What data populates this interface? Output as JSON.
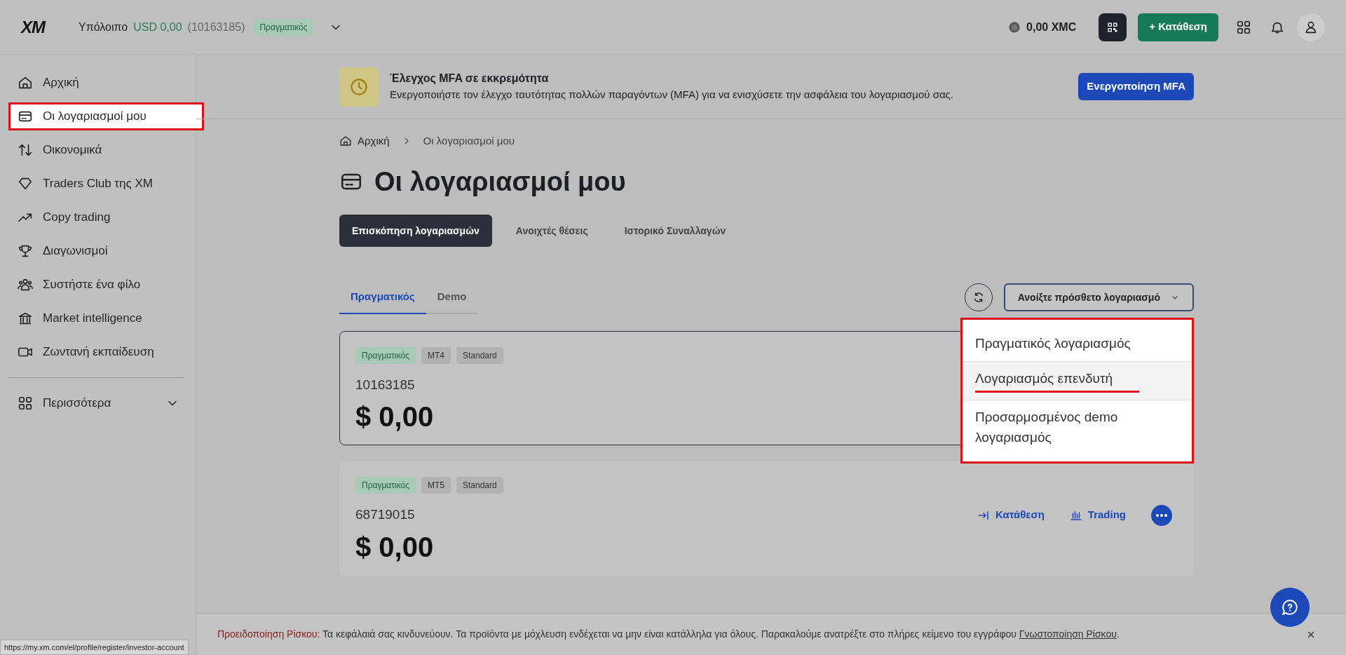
{
  "header": {
    "logo": "XM",
    "balance_label": "Υπόλοιπο",
    "balance": "USD 0,00",
    "account": "(10163185)",
    "account_type": "Πραγματικός",
    "xmc": "0,00 XMC",
    "deposit_button": "+ Κατάθεση"
  },
  "sidebar": {
    "items": [
      {
        "label": "Αρχική",
        "kind": "home",
        "selected": false
      },
      {
        "label": "Οι λογαριασμοί μου",
        "kind": "card",
        "selected": true
      },
      {
        "label": "Οικονομικά",
        "kind": "transfer",
        "selected": false
      },
      {
        "label": "Traders Club της XM",
        "kind": "diamond",
        "selected": false
      },
      {
        "label": "Copy trading",
        "kind": "trend",
        "selected": false
      },
      {
        "label": "Διαγωνισμοί",
        "kind": "trophy",
        "selected": false
      },
      {
        "label": "Συστήστε ένα φίλο",
        "kind": "people",
        "selected": false
      },
      {
        "label": "Market intelligence",
        "kind": "bank",
        "selected": false
      },
      {
        "label": "Ζωντανή εκπαίδευση",
        "kind": "video",
        "selected": false
      }
    ],
    "more": {
      "label": "Περισσότερα",
      "expanded": false
    }
  },
  "banner": {
    "title": "Έλεγχος MFA σε εκκρεμότητα",
    "text": "Ενεργοποιήστε τον έλεγχο ταυτότητας πολλών παραγόντων (MFA) για να ενισχύσετε την ασφάλεια του λογαριασμού σας.",
    "button": "Ενεργοποίηση MFA"
  },
  "breadcrumb": [
    "Αρχική",
    "Οι λογαριασμοί μου"
  ],
  "page_title": "Οι λογαριασμοί μου",
  "view_tabs": [
    {
      "label": "Επισκόπηση λογαριασμών",
      "selected": true
    },
    {
      "label": "Ανοιχτές θέσεις",
      "selected": false
    },
    {
      "label": "Ιστορικό Συναλλαγών",
      "selected": false
    }
  ],
  "account_tabs": [
    {
      "label": "Πραγματικός",
      "selected": true
    },
    {
      "label": "Demo",
      "selected": false
    }
  ],
  "open_account_button": "Ανοίξτε πρόσθετο λογαριασμό",
  "dropdown": {
    "items": [
      {
        "label": "Πραγματικός λογαριασμός",
        "selected": false
      },
      {
        "label": "Λογαριασμός επενδυτή",
        "selected": true
      },
      {
        "label": "Προσαρμοσμένος demo λογαριασμός",
        "selected": false
      }
    ]
  },
  "accounts": [
    {
      "tags": [
        {
          "label": "Πραγματικός",
          "kind": "type"
        },
        {
          "label": "MT4",
          "kind": "plain"
        },
        {
          "label": "Standard",
          "kind": "plain"
        }
      ],
      "number": "10163185",
      "balance": "$ 0,00",
      "selected": true
    },
    {
      "tags": [
        {
          "label": "Πραγματικός",
          "kind": "type"
        },
        {
          "label": "MT5",
          "kind": "plain"
        },
        {
          "label": "Standard",
          "kind": "plain"
        }
      ],
      "number": "68719015",
      "balance": "$ 0,00",
      "selected": false,
      "actions": [
        {
          "label": "Κατάθεση",
          "kind": "deposit"
        },
        {
          "label": "Trading",
          "kind": "chart"
        }
      ]
    }
  ],
  "risk_warning": {
    "label": "Προειδοποίηση Ρίσκου:",
    "text": "Τα κεφάλαιά σας κινδυνεύουν. Τα προϊόντα με μόχλευση ενδέχεται να μην είναι κατάλληλα για όλους. Παρακαλούμε ανατρέξτε στο πλήρες κείμενο του εγγράφου",
    "link": "Γνωστοποίηση Ρίσκου",
    "end": "."
  },
  "status_url": "https://my.xm.com/el/profile/register/investor-account"
}
